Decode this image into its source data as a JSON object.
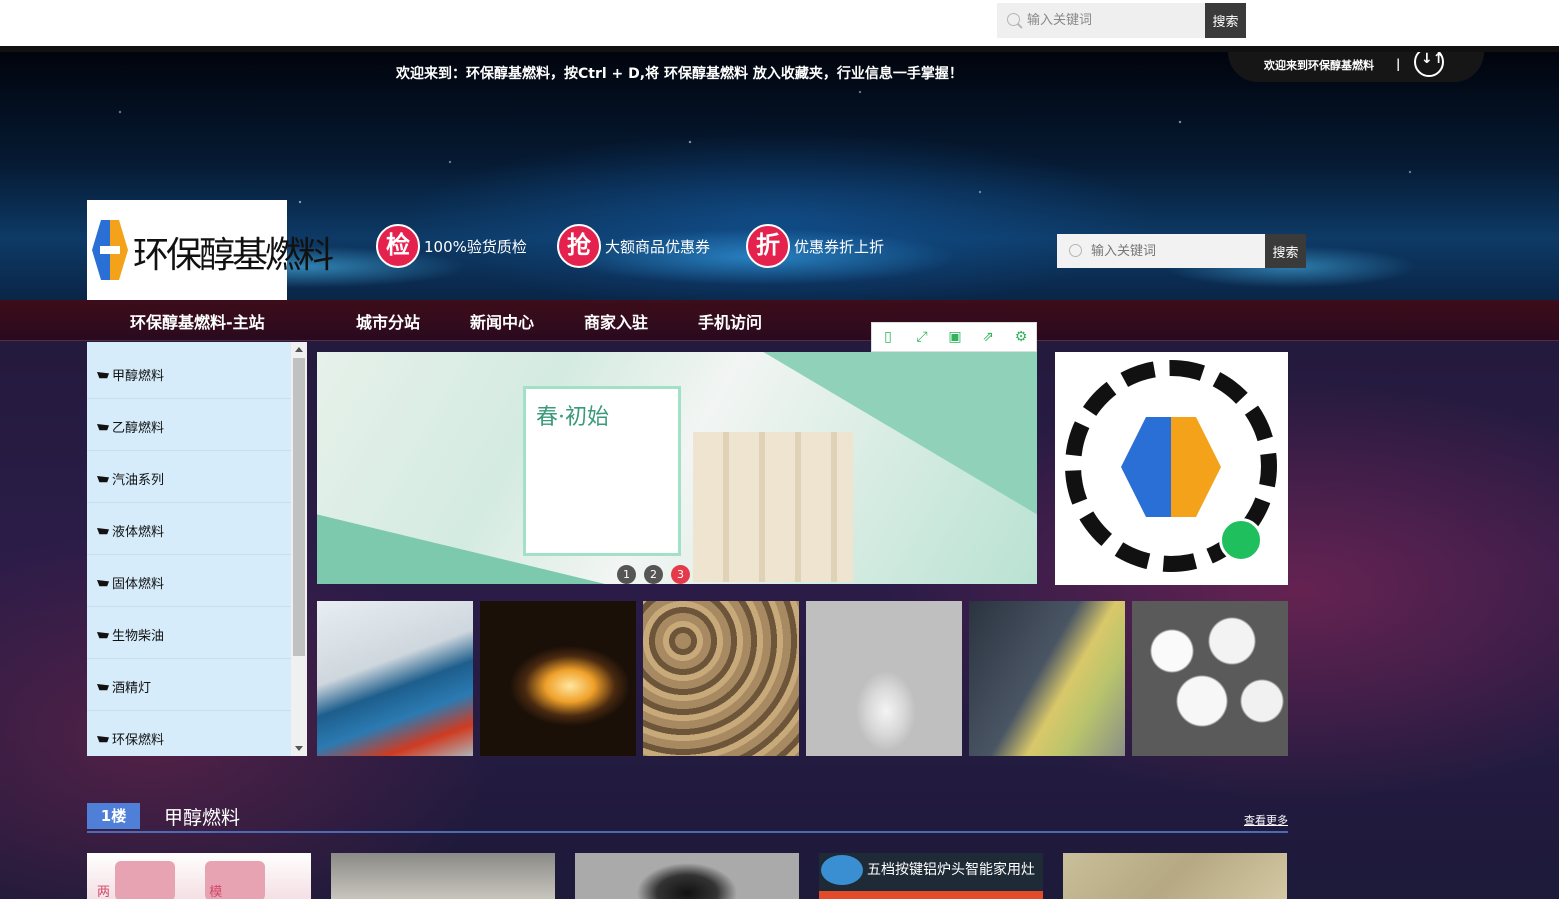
{
  "top_search": {
    "placeholder": "输入关键词",
    "button": "搜索"
  },
  "header": {
    "welcome": "欢迎来到：环保醇基燃料，按Ctrl + D,将 环保醇基燃料 放入收藏夹，行业信息一手掌握！",
    "welcome_tab": "欢迎来到环保醇基燃料",
    "welcome_sep": "|",
    "logo_text": "环保醇基燃料",
    "badges": [
      {
        "char": "检",
        "text": "100%验货质检"
      },
      {
        "char": "抢",
        "text": "大额商品优惠券"
      },
      {
        "char": "折",
        "text": "优惠券折上折"
      }
    ],
    "search": {
      "placeholder": "输入关键词",
      "button": "搜索"
    }
  },
  "nav": {
    "items": [
      "环保醇基燃料-主站",
      "城市分站",
      "新闻中心",
      "商家入驻",
      "手机访问"
    ]
  },
  "toolbar": {
    "icons": [
      "mobile-icon",
      "fullscreen-icon",
      "save-icon",
      "share-icon",
      "settings-icon"
    ]
  },
  "sidebar": {
    "items": [
      "甲醇燃料",
      "乙醇燃料",
      "汽油系列",
      "液体燃料",
      "固体燃料",
      "生物柴油",
      "酒精灯",
      "环保燃料"
    ]
  },
  "slider": {
    "headline": "春·初始",
    "dots": [
      "1",
      "2",
      "3"
    ],
    "active_dot": 3
  },
  "thumbnails": [
    "boiler-image",
    "fire-image",
    "pellets-image",
    "alcohol-lamp-image",
    "fuel-bag-image",
    "solid-fuel-image"
  ],
  "floor": {
    "num": "1楼",
    "title": "甲醇燃料",
    "more": "查看更多"
  },
  "products": [
    {
      "label": "两 　　　　　　　 模"
    },
    {
      "label": ""
    },
    {
      "label": ""
    },
    {
      "label": "五档按键铝炉头智能家用灶"
    },
    {
      "label": ""
    }
  ],
  "colors": {
    "accent_blue": "#4f7fd6",
    "badge_red": "#e4224d",
    "sidebar_bg": "#d6ecfb",
    "active_dot": "#e53a4a"
  }
}
